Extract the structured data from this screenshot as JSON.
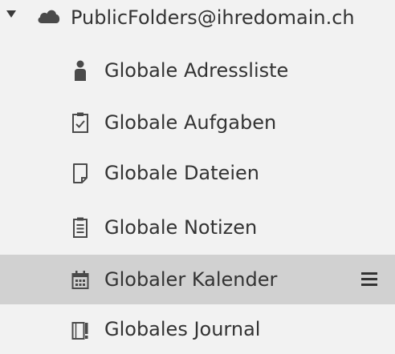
{
  "colors": {
    "background": "#f2f2f2",
    "selected_row": "#d1d1d1",
    "text": "#333333",
    "icon": "#4a4a4a"
  },
  "tree": {
    "root": {
      "label": "PublicFolders@ihredomain.ch",
      "icon": "cloud-icon",
      "expanded": true
    },
    "items": [
      {
        "label": "Globale Adressliste",
        "icon": "person-icon",
        "selected": false
      },
      {
        "label": "Globale Aufgaben",
        "icon": "task-checklist-icon",
        "selected": false
      },
      {
        "label": "Globale Dateien",
        "icon": "file-icon",
        "selected": false
      },
      {
        "label": "Globale Notizen",
        "icon": "notes-icon",
        "selected": false
      },
      {
        "label": "Globaler Kalender",
        "icon": "calendar-icon",
        "selected": true,
        "menu_icon": "hamburger-menu-icon"
      },
      {
        "label": "Globales Journal",
        "icon": "journal-icon",
        "selected": false
      }
    ]
  }
}
